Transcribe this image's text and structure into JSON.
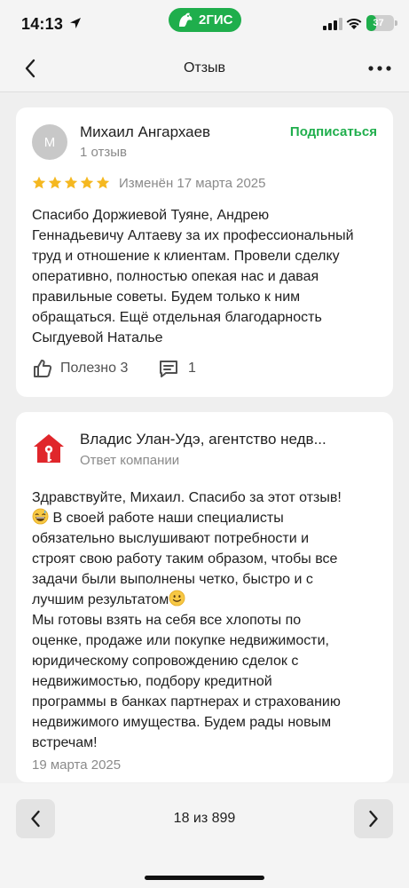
{
  "status_bar": {
    "time": "14:13",
    "app_badge": "2ГИС",
    "battery": "37",
    "battery_level": 0.37,
    "icons": [
      "location-arrow-icon",
      "signal-icon",
      "wifi-icon",
      "battery-icon"
    ]
  },
  "nav": {
    "title": "Отзыв",
    "back_icon": "chevron-left-icon",
    "more_icon": "more-horizontal-icon"
  },
  "review": {
    "avatar_initial": "М",
    "author": "Михаил Ангархаев",
    "author_reviews": "1 отзыв",
    "subscribe": "Подписаться",
    "rating": 5,
    "rating_max": 5,
    "date": "Изменён 17 марта 2025",
    "text": "Спасибо Доржиевой Туяне, Андрею\nГеннадьевичу Алтаеву за их профессиональный\nтруд и отношение к клиентам. Провели сделку\nоперативно, полностью опекая нас и давая\nправильные советы. Будем только к ним\nобращаться. Ещё отдельная благодарность\nСыгдуевой Наталье",
    "useful_label": "Полезно 3",
    "comments_count": "1",
    "colors": {
      "star": "#f5b820",
      "accent": "#1fae4c"
    }
  },
  "reply": {
    "company": "Владис Улан-Удэ, агентство недв...",
    "company_meta": "Ответ компании",
    "line1": "Здравствуйте, Михаил. Спасибо за этот отзыв!",
    "line2": "В своей работе наши специалисты",
    "block_a": "обязательно выслушивают потребности и\nстроят свою работу таким образом, чтобы все\nзадачи были выполнены четко, быстро и с",
    "line_with_emoji": "лучшим результатом",
    "block_b": "Мы готовы взять на себя все хлопоты по\nоценке, продаже или покупке недвижимости,\nюридическому сопровождению сделок с\nнедвижимостью, подбору кредитной\nпрограммы в банках партнерах и страхованию\nнедвижимого имущества. Будем рады новым\nвстречам!",
    "date": "19 марта 2025",
    "colors": {
      "logo": "#e0262b"
    }
  },
  "pager": {
    "text": "18 из 899",
    "prev_icon": "chevron-left-icon",
    "next_icon": "chevron-right-icon"
  }
}
